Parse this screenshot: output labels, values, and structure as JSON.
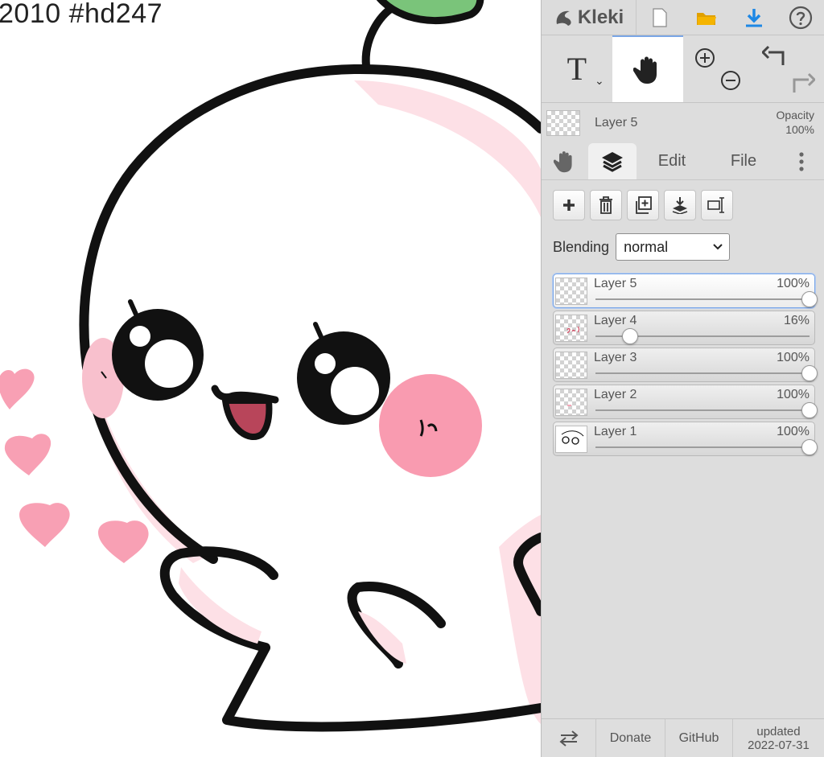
{
  "canvas": {
    "caption": "2010 #hd247"
  },
  "app": {
    "logo_text": "Kleki"
  },
  "current_layer": {
    "name": "Layer 5",
    "opacity_label": "Opacity",
    "opacity_value": "100%"
  },
  "tabs": {
    "edit": "Edit",
    "file": "File"
  },
  "blending": {
    "label": "Blending",
    "value": "normal"
  },
  "layers": [
    {
      "name": "Layer 5",
      "opacity_text": "100%",
      "opacity": 1.0,
      "selected": true
    },
    {
      "name": "Layer 4",
      "opacity_text": "16%",
      "opacity": 0.16,
      "selected": false
    },
    {
      "name": "Layer 3",
      "opacity_text": "100%",
      "opacity": 1.0,
      "selected": false
    },
    {
      "name": "Layer 2",
      "opacity_text": "100%",
      "opacity": 1.0,
      "selected": false
    },
    {
      "name": "Layer 1",
      "opacity_text": "100%",
      "opacity": 1.0,
      "selected": false
    }
  ],
  "footer": {
    "donate": "Donate",
    "github": "GitHub",
    "updated_label": "updated",
    "updated_date": "2022-07-31"
  },
  "colors": {
    "accent_blue": "#1e88e5",
    "folder_yellow": "#f5b400",
    "cheek_pink": "#f99bb0",
    "heart_pink": "#f8a0b4",
    "sprout_green": "#7ac47a",
    "mouth_red": "#b8455a"
  }
}
